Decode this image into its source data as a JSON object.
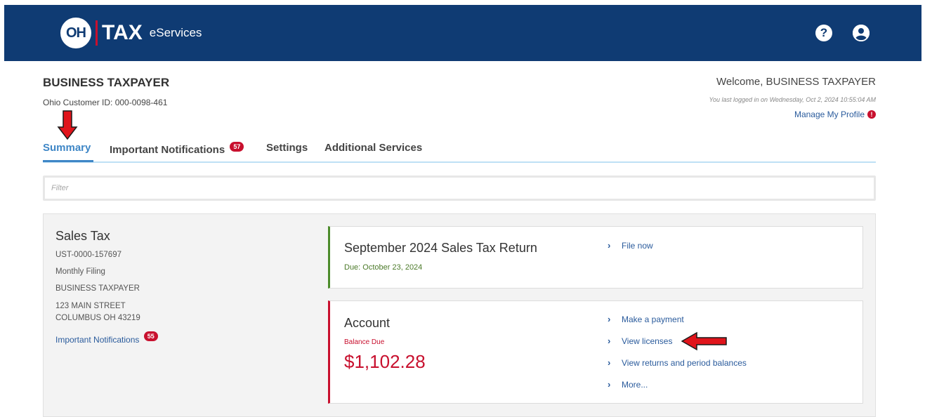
{
  "header": {
    "logo_oh": "OH",
    "logo_tax": "TAX",
    "logo_eservices": "eServices",
    "help_icon": "question-circle-icon",
    "user_icon": "user-circle-icon"
  },
  "account": {
    "name": "BUSINESS TAXPAYER",
    "customer_id": "Ohio Customer ID: 000-0098-461",
    "welcome": "Welcome, BUSINESS TAXPAYER",
    "last_login": "You last logged in on Wednesday, Oct 2, 2024 10:55:04 AM",
    "manage_profile": "Manage My Profile",
    "manage_profile_badge": "!"
  },
  "tabs": [
    {
      "label": "Summary",
      "badge": ""
    },
    {
      "label": "Important Notifications",
      "badge": "57"
    },
    {
      "label": "Settings",
      "badge": ""
    },
    {
      "label": "Additional Services",
      "badge": ""
    }
  ],
  "filter": {
    "placeholder": "Filter"
  },
  "sales_tax": {
    "title": "Sales Tax",
    "account_number": "UST-0000-157697",
    "filing": "Monthly Filing",
    "business": "BUSINESS TAXPAYER",
    "address_line1": "123 MAIN STREET",
    "address_line2": "COLUMBUS OH 43219",
    "notifications_label": "Important Notifications",
    "notifications_badge": "55"
  },
  "return_card": {
    "title": "September 2024 Sales Tax Return",
    "due": "Due: October 23, 2024",
    "link": "File now"
  },
  "account_card": {
    "title": "Account",
    "balance_label": "Balance Due",
    "balance_value": "$1,102.28",
    "links": [
      "Make a payment",
      "View licenses",
      "View returns and period balances",
      "More..."
    ]
  },
  "colors": {
    "header_bg": "#0f3b73",
    "accent_blue": "#3e86c6",
    "alert_red": "#c8102e",
    "due_green": "#4c8c2b",
    "annotation_arrow": "#e0141b"
  }
}
